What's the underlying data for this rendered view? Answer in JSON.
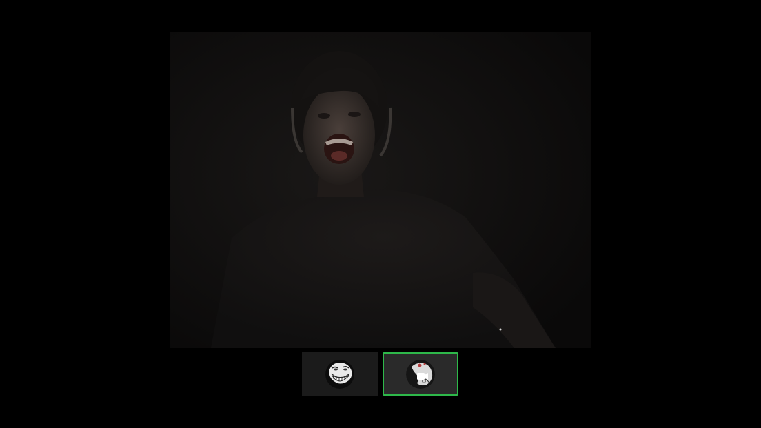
{
  "call": {
    "main_feed": {
      "icon": "webcam-video-feed"
    },
    "participants": [
      {
        "icon": "trollface-avatar-icon",
        "selected": false
      },
      {
        "icon": "trollface-avatar-icon",
        "selected": true,
        "overlay_icon": "camera-off-icon"
      }
    ]
  },
  "colors": {
    "background": "#000000",
    "video_bg": "#0b0a0a",
    "thumb_bg": "#1b1b1b",
    "selected_thumb_bg": "#2a2a2a",
    "selected_border": "#2eb84a"
  }
}
